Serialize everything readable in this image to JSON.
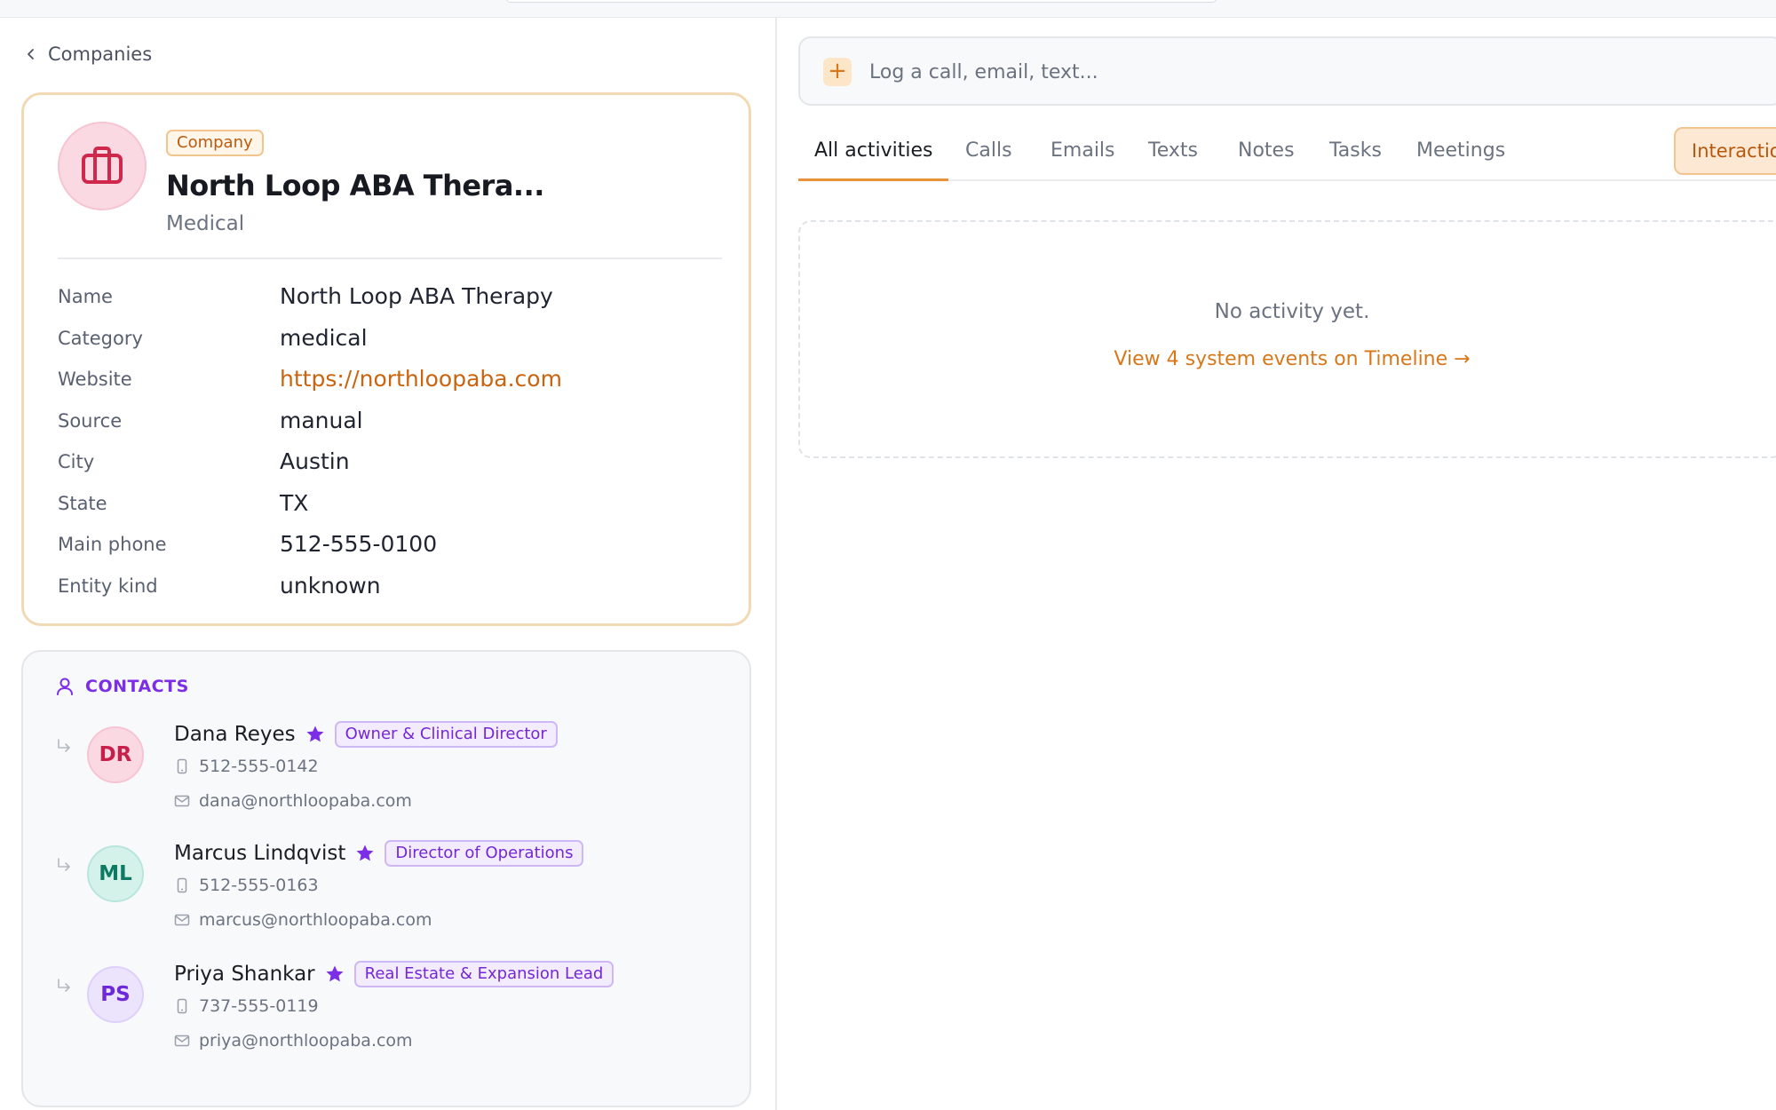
{
  "nav": {
    "back_label": "Companies"
  },
  "company": {
    "type_badge": "Company",
    "display_name": "North Loop ABA Thera...",
    "subtitle": "Medical",
    "fields": [
      {
        "label": "Name",
        "value": "North Loop ABA Therapy"
      },
      {
        "label": "Category",
        "value": "medical"
      },
      {
        "label": "Website",
        "value": "https://northloopaba.com"
      },
      {
        "label": "Source",
        "value": "manual"
      },
      {
        "label": "City",
        "value": "Austin"
      },
      {
        "label": "State",
        "value": "TX"
      },
      {
        "label": "Main phone",
        "value": "512-555-0100"
      },
      {
        "label": "Entity kind",
        "value": "unknown"
      }
    ]
  },
  "contacts": {
    "title": "CONTACTS",
    "items": [
      {
        "initials": "DR",
        "name": "Dana Reyes",
        "role": "Owner & Clinical Director",
        "phone": "512-555-0142",
        "email": "dana@northloopaba.com"
      },
      {
        "initials": "ML",
        "name": "Marcus Lindqvist",
        "role": "Director of Operations",
        "phone": "512-555-0163",
        "email": "marcus@northloopaba.com"
      },
      {
        "initials": "PS",
        "name": "Priya Shankar",
        "role": "Real Estate & Expansion Lead",
        "phone": "737-555-0119",
        "email": "priya@northloopaba.com"
      }
    ]
  },
  "activity": {
    "log_placeholder": "Log a call, email, text...",
    "tabs": [
      "All activities",
      "Calls",
      "Emails",
      "Texts",
      "Notes",
      "Tasks",
      "Meetings"
    ],
    "interactions_tab": "Interactions",
    "empty_text": "No activity yet.",
    "timeline_link": "View 4 system events on Timeline →"
  },
  "colors": {
    "accent": "#d8771a",
    "contacts_purple": "#7c2ee6",
    "card_border": "#f1d9b5"
  }
}
